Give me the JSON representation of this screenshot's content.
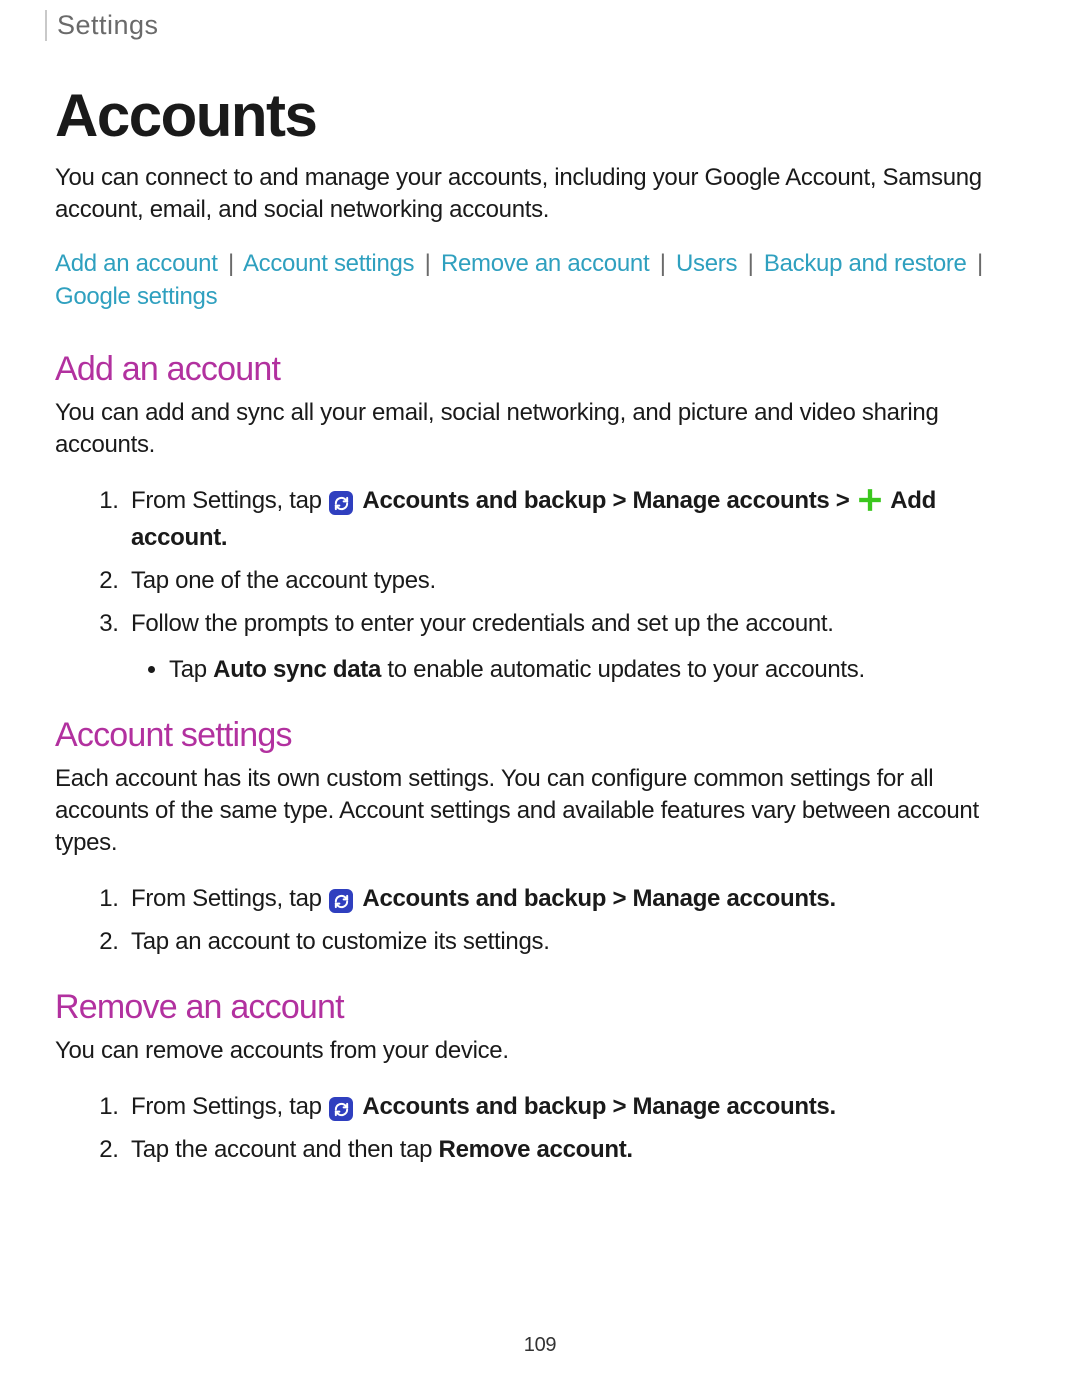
{
  "breadcrumb": "Settings",
  "title": "Accounts",
  "intro": "You can connect to and manage your accounts, including your Google Account, Samsung account, email, and social networking accounts.",
  "links": {
    "add": "Add an account",
    "settings": "Account settings",
    "remove": "Remove an account",
    "users": "Users",
    "backup": "Backup and restore",
    "google": "Google settings",
    "sep": "|"
  },
  "sections": {
    "add": {
      "heading": "Add an account",
      "body": "You can add and sync all your email, social networking, and picture and video sharing accounts.",
      "step1_prefix": "From Settings, tap ",
      "step1_bold1": "Accounts and backup > Manage accounts > ",
      "step1_bold2": "Add account",
      "step2": "Tap one of the account types.",
      "step3": "Follow the prompts to enter your credentials and set up the account.",
      "sub_prefix": "Tap ",
      "sub_bold": "Auto sync data",
      "sub_suffix": " to enable automatic updates to your accounts."
    },
    "settings": {
      "heading": "Account settings",
      "body": "Each account has its own custom settings. You can configure common settings for all accounts of the same type. Account settings and available features vary between account types.",
      "step1_prefix": "From Settings, tap ",
      "step1_bold": "Accounts and backup > Manage accounts",
      "step2": "Tap an account to customize its settings."
    },
    "remove": {
      "heading": "Remove an account",
      "body": "You can remove accounts from your device.",
      "step1_prefix": "From Settings, tap ",
      "step1_bold": "Accounts and backup > Manage accounts",
      "step2_prefix": "Tap the account and then tap ",
      "step2_bold": "Remove account"
    }
  },
  "page_number": "109",
  "icons": {
    "sync": "sync-icon",
    "plus": "plus-icon"
  }
}
